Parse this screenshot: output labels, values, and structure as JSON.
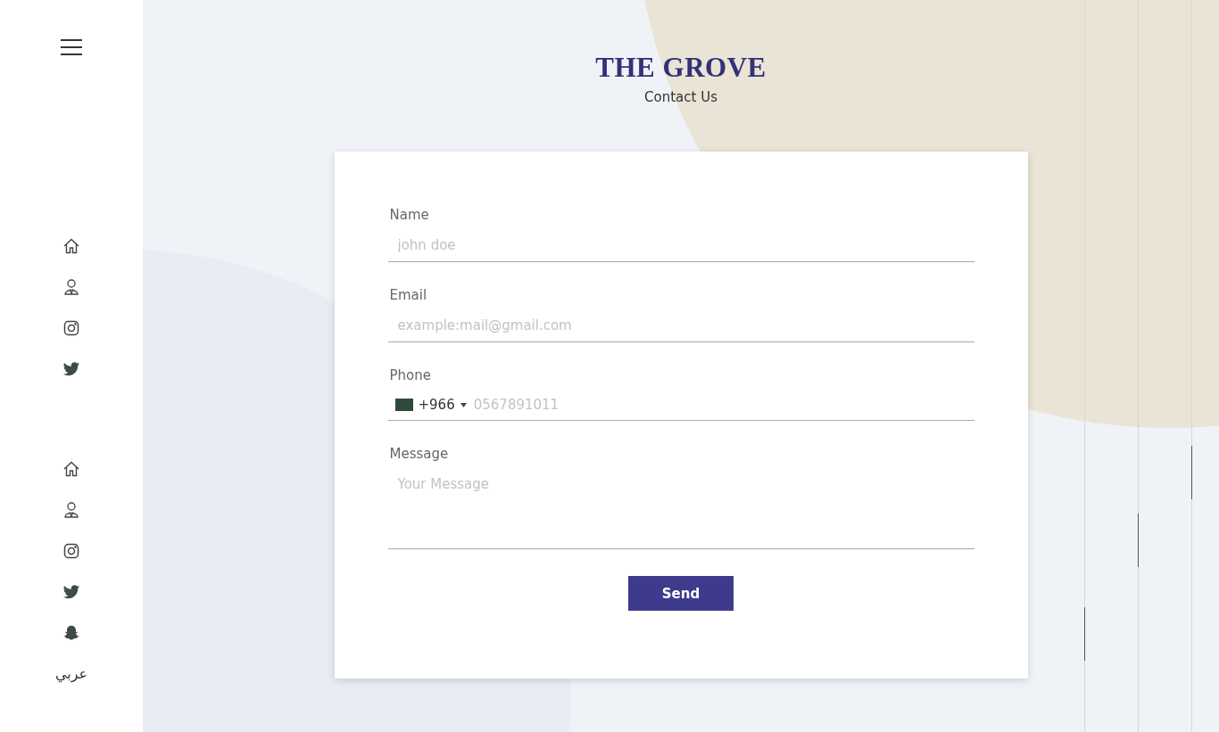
{
  "sidebar": {
    "top_icons": [
      {
        "kind": "home"
      },
      {
        "kind": "person"
      },
      {
        "kind": "instagram"
      },
      {
        "kind": "twitter"
      }
    ],
    "bottom_icons": [
      {
        "kind": "home"
      },
      {
        "kind": "person"
      },
      {
        "kind": "instagram"
      },
      {
        "kind": "twitter"
      },
      {
        "kind": "snapchat"
      }
    ],
    "language_link": "عربي"
  },
  "header": {
    "brand": "THE GROVE",
    "subtitle": "Contact Us"
  },
  "form": {
    "fields": [
      {
        "kind": "text",
        "label": "Name",
        "placeholder": "john doe"
      },
      {
        "kind": "text",
        "label": "Email",
        "placeholder": "example:mail@gmail.com"
      },
      {
        "kind": "phone",
        "label": "Phone",
        "dial_code": "+966",
        "placeholder": "0567891011"
      },
      {
        "kind": "textarea",
        "label": "Message",
        "placeholder": "Your Message"
      }
    ],
    "submit": "Send"
  }
}
